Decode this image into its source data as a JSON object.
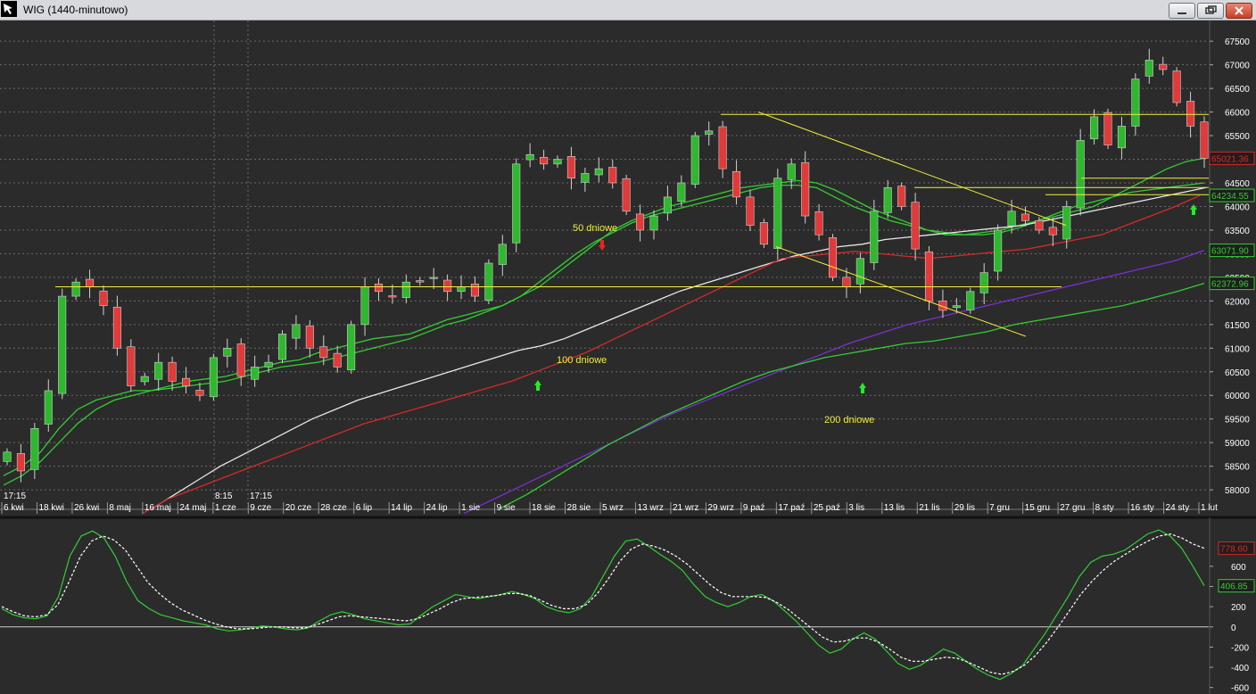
{
  "window": {
    "title": "WIG (1440-minutowo)",
    "minimize_label": "minimize",
    "restore_label": "restore",
    "close_label": "close"
  },
  "colors": {
    "background": "#2b2b2b",
    "grid": "#6a6a6a",
    "text": "#ffffff",
    "up_candle": "#2fb82f",
    "down_candle": "#e03a3a",
    "ma_white": "#e8e8e8",
    "ma_red": "#d42a2a",
    "ma_purple": "#7a2fd6",
    "ma_green": "#33cc33",
    "trend_lines": "#f2ee3a",
    "annotation_text": "#f2ee3a",
    "arrow_up": "#22ee22",
    "arrow_down": "#ee2222",
    "macd_line": "#33cc33",
    "macd_signal": "#ffffff"
  },
  "chart_data": [
    {
      "type": "candlestick",
      "title": "WIG (1440-minutowo)",
      "ylim": [
        57700,
        67900
      ],
      "y_ticks": [
        58000,
        58500,
        59000,
        59500,
        60000,
        60500,
        61000,
        61500,
        62000,
        62500,
        63000,
        63500,
        64000,
        64500,
        65000,
        65500,
        66000,
        66500,
        67000,
        67500
      ],
      "y_tick_labels": [
        "58000",
        "58500",
        "59000",
        "59500",
        "60000",
        "60500",
        "61000",
        "61500",
        "62000",
        "62500",
        "63000",
        "63500",
        "64000",
        "64500",
        "65000",
        "65500",
        "66000",
        "66500",
        "67000",
        "67500"
      ],
      "x_labels": [
        "6 kwi",
        "18 kwi",
        "26 kwi",
        "8 maj",
        "16 maj",
        "24 maj",
        "1 cze",
        "9 cze",
        "20 cze",
        "28 cze",
        "6 lip",
        "14 lip",
        "24 lip",
        "1 sie",
        "9 sie",
        "18 sie",
        "28 sie",
        "5 wrz",
        "13 wrz",
        "21 wrz",
        "29 wrz",
        "9 paź",
        "17 paź",
        "25 paź",
        "3 lis",
        "13 lis",
        "21 lis",
        "29 lis",
        "7 gru",
        "15 gru",
        "27 gru",
        "8 sty",
        "16 sty",
        "24 sty",
        "1 lut"
      ],
      "time_labels": [
        "17:15",
        "8:15",
        "17:15"
      ],
      "close_series": [
        58800,
        58400,
        59300,
        60100,
        62100,
        62400,
        62300,
        61900,
        61000,
        60200,
        60400,
        60700,
        60300,
        60200,
        60000,
        60800,
        61000,
        60400,
        60600,
        60700,
        61300,
        61500,
        61000,
        60800,
        60600,
        61500,
        62300,
        62200,
        62100,
        62400,
        62400,
        62500,
        62200,
        62300,
        62100,
        62800,
        63200,
        64900,
        65100,
        64900,
        65000,
        64600,
        64700,
        64800,
        64500,
        63900,
        63500,
        63800,
        64200,
        64500,
        65500,
        65600,
        64800,
        64200,
        63600,
        63200,
        64600,
        64900,
        63800,
        63400,
        62500,
        62300,
        62900,
        63900,
        64400,
        64000,
        63100,
        62000,
        61800,
        61900,
        62200,
        62600,
        63500,
        63900,
        63700,
        63500,
        63400,
        64000,
        65400,
        65900,
        65300,
        65700,
        66700,
        67100,
        66900,
        66200,
        65700,
        65021.36
      ],
      "series": [
        {
          "name": "",
          "color": "ma_green",
          "values": [
            58300,
            58500,
            58800,
            59300,
            59700,
            59900,
            60000,
            60100,
            60100,
            60200,
            60300,
            60350,
            60400,
            60500,
            60600,
            60700,
            60750,
            60900,
            61000,
            61100,
            61200,
            61250,
            61300,
            61450,
            61600,
            61700,
            61800,
            61900,
            62100,
            62300,
            62600,
            62900,
            63200,
            63500,
            63700,
            63850,
            64000,
            64100,
            64200,
            64300,
            64400,
            64450,
            64500,
            64550,
            64500,
            64350,
            64150,
            63950,
            63800,
            63650,
            63500,
            63400,
            63400,
            63450,
            63500,
            63600,
            63700,
            63800,
            63900,
            64000,
            64200,
            64400,
            64600,
            64800,
            64950,
            65021.36
          ]
        },
        {
          "name": "",
          "color": "ma_green",
          "values": [
            58100,
            58300,
            58600,
            59000,
            59400,
            59700,
            59900,
            60000,
            60100,
            60150,
            60200,
            60250,
            60300,
            60400,
            60500,
            60600,
            60650,
            60700,
            60800,
            60900,
            61000,
            61100,
            61200,
            61350,
            61500,
            61600,
            61750,
            61900,
            62100,
            62400,
            62700,
            63000,
            63250,
            63450,
            63650,
            63800,
            63900,
            64000,
            64100,
            64200,
            64300,
            64400,
            64450,
            64450,
            64400,
            64200,
            64000,
            63850,
            63700,
            63600,
            63500,
            63450,
            63400,
            63400,
            63450,
            63550,
            63700,
            63850,
            64000,
            64100,
            64200,
            64300,
            64350,
            64400,
            64450,
            64500
          ]
        },
        {
          "name": "",
          "color": "ma_white",
          "values": [
            57600,
            57900,
            58200,
            58500,
            58750,
            59000,
            59250,
            59500,
            59700,
            59900,
            60050,
            60200,
            60350,
            60500,
            60650,
            60800,
            60950,
            61050,
            61200,
            61400,
            61600,
            61800,
            62000,
            62200,
            62350,
            62500,
            62650,
            62800,
            62950,
            63050,
            63150,
            63200,
            63300,
            63350,
            63400,
            63450,
            63500,
            63550,
            63600,
            63700,
            63800,
            63900,
            64000,
            64100,
            64200,
            64300,
            64400
          ]
        },
        {
          "name": "",
          "color": "ma_red",
          "values": [
            57500,
            57800,
            58000,
            58200,
            58400,
            58600,
            58800,
            59000,
            59200,
            59400,
            59550,
            59700,
            59850,
            60000,
            60150,
            60300,
            60500,
            60700,
            60900,
            61150,
            61400,
            61650,
            61900,
            62150,
            62400,
            62650,
            62900,
            62950,
            63000,
            63050,
            63000,
            62950,
            62900,
            62950,
            63000,
            63050,
            63100,
            63200,
            63300,
            63400,
            63600,
            63800,
            64000,
            64234.55
          ]
        },
        {
          "name": "",
          "color": "ma_purple",
          "values": [
            57500,
            57800,
            58100,
            58400,
            58700,
            59000,
            59300,
            59600,
            59850,
            60100,
            60350,
            60600,
            60850,
            61100,
            61300,
            61500,
            61650,
            61800,
            61950,
            62100,
            62250,
            62400,
            62550,
            62700,
            62850,
            63071.9
          ]
        },
        {
          "name": "",
          "color": "ma_green",
          "values": [
            57600,
            57900,
            58250,
            58600,
            58950,
            59250,
            59550,
            59800,
            60050,
            60300,
            60500,
            60650,
            60800,
            60900,
            61000,
            61100,
            61150,
            61250,
            61350,
            61500,
            61600,
            61700,
            61800,
            61900,
            62050,
            62200,
            62372.96
          ]
        }
      ],
      "price_tags": [
        {
          "label": "65021.36",
          "value": 65021.36,
          "color": "ma_red"
        },
        {
          "label": "64234.55",
          "value": 64234.55,
          "color": "ma_green"
        },
        {
          "label": "63071.90",
          "value": 63071.9,
          "color": "ma_green"
        },
        {
          "label": "62372.96",
          "value": 62372.96,
          "color": "ma_green"
        }
      ],
      "horizontal_levels": [
        62300,
        65950,
        64600,
        64400,
        64250
      ],
      "annotations": [
        "50 dniowe",
        "100 dniowe",
        "200 dniowe"
      ]
    },
    {
      "type": "line",
      "ylim": [
        -620,
        1040
      ],
      "y_ticks": [
        -600,
        -400,
        -200,
        0,
        200,
        400,
        600
      ],
      "y_tick_labels": [
        "-600",
        "-400",
        "-200",
        "0",
        "200",
        "400",
        "600"
      ],
      "series": [
        {
          "name": "",
          "color": "macd_line",
          "values": [
            180,
            120,
            90,
            80,
            110,
            300,
            700,
            900,
            950,
            880,
            700,
            450,
            260,
            180,
            120,
            90,
            60,
            40,
            20,
            -20,
            -40,
            -30,
            -10,
            10,
            0,
            -20,
            -30,
            -10,
            60,
            120,
            150,
            120,
            80,
            60,
            40,
            20,
            30,
            120,
            200,
            260,
            320,
            300,
            280,
            300,
            320,
            350,
            320,
            280,
            200,
            160,
            140,
            180,
            300,
            500,
            700,
            850,
            870,
            800,
            720,
            650,
            560,
            420,
            300,
            240,
            200,
            240,
            300,
            320,
            260,
            160,
            60,
            -60,
            -180,
            -260,
            -220,
            -120,
            -60,
            -120,
            -240,
            -360,
            -420,
            -380,
            -300,
            -220,
            -260,
            -340,
            -420,
            -480,
            -520,
            -460,
            -380,
            -220,
            -60,
            120,
            300,
            500,
            640,
            700,
            720,
            760,
            840,
            920,
            960,
            900,
            780,
            600,
            406.85
          ]
        },
        {
          "name": "",
          "color": "macd_signal",
          "values": [
            200,
            150,
            110,
            100,
            120,
            220,
            450,
            700,
            850,
            900,
            860,
            760,
            600,
            440,
            330,
            240,
            170,
            120,
            70,
            30,
            0,
            -20,
            -20,
            -10,
            0,
            0,
            -10,
            -10,
            20,
            60,
            100,
            110,
            100,
            90,
            80,
            70,
            60,
            80,
            130,
            180,
            240,
            280,
            290,
            300,
            310,
            330,
            330,
            310,
            260,
            210,
            180,
            180,
            220,
            330,
            480,
            650,
            770,
            820,
            800,
            760,
            700,
            620,
            520,
            420,
            340,
            300,
            300,
            300,
            290,
            240,
            170,
            80,
            -10,
            -100,
            -150,
            -140,
            -110,
            -110,
            -150,
            -220,
            -300,
            -340,
            -340,
            -320,
            -300,
            -310,
            -350,
            -400,
            -450,
            -470,
            -440,
            -380,
            -280,
            -150,
            0,
            160,
            320,
            450,
            560,
            650,
            720,
            790,
            850,
            900,
            920,
            880,
            820,
            778.6
          ]
        }
      ],
      "value_tags": [
        {
          "label": "778.60",
          "value": 778.6,
          "color": "ma_red"
        },
        {
          "label": "406.85",
          "value": 406.85,
          "color": "ma_green"
        }
      ]
    }
  ]
}
